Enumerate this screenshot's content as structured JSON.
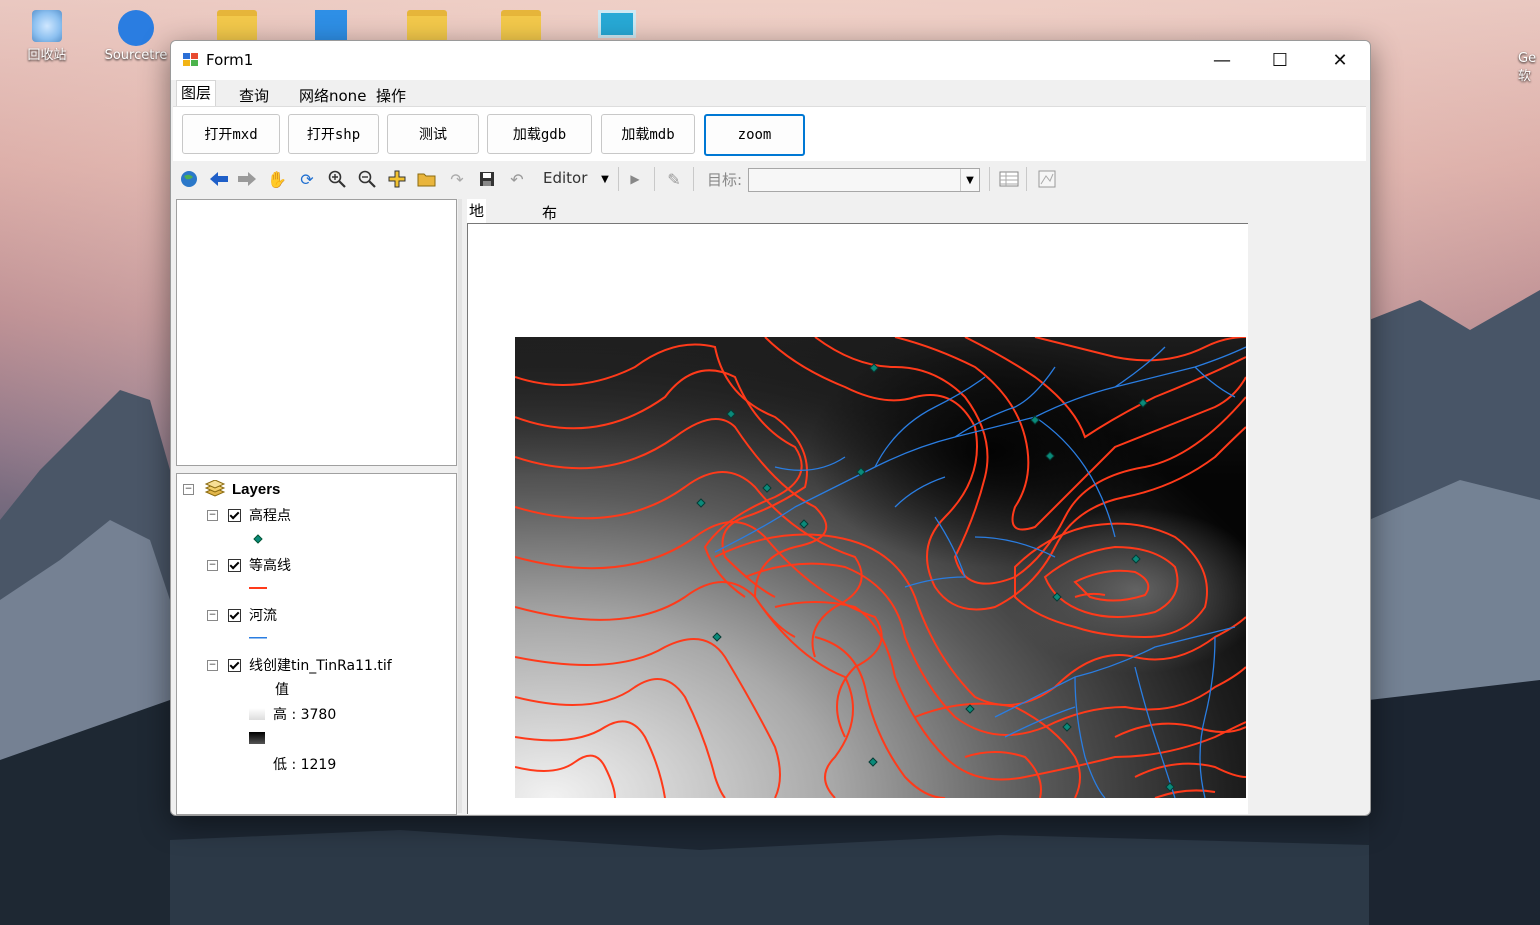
{
  "desktop": {
    "icons": [
      {
        "label": "回收站",
        "icon": "recycle-bin-icon"
      },
      {
        "label": "Sourcetre",
        "icon": "sourcetree-icon"
      },
      {
        "label": "",
        "icon": "folder-icon"
      },
      {
        "label": "",
        "icon": "tool-app-icon"
      },
      {
        "label": "",
        "icon": "folder-icon"
      },
      {
        "label": "",
        "icon": "folder-icon"
      },
      {
        "label": "",
        "icon": "monitor-icon"
      }
    ],
    "right_edge_text": [
      "Ge",
      "软"
    ]
  },
  "window": {
    "title": "Form1",
    "controls": {
      "minimize": "—",
      "maximize": "☐",
      "close": "✕"
    }
  },
  "menu": {
    "items": [
      "图层",
      "查询",
      "网络none",
      "操作"
    ],
    "active_index": 0
  },
  "buttons": [
    "打开mxd",
    "打开shp",
    "测试",
    "加载gdb",
    "加载mdb",
    "zoom"
  ],
  "toolbar": {
    "editor_label": "Editor",
    "target_label": "目标:",
    "target_value": ""
  },
  "view_tabs": [
    "地图视图",
    "布局视图"
  ],
  "toc": {
    "root": "Layers",
    "layers": [
      {
        "name": "高程点",
        "checked": true,
        "symbol": "point",
        "color": "#0a8a7a"
      },
      {
        "name": "等高线",
        "checked": true,
        "symbol": "line",
        "color": "#ff3a1a"
      },
      {
        "name": "河流",
        "checked": true,
        "symbol": "line",
        "color": "#2a7de1"
      },
      {
        "name": "线创建tin_TinRa11.tif",
        "checked": true,
        "symbol": "raster",
        "legend_title": "值",
        "high_label": "高 : 3780",
        "low_label": "低 : 1219"
      }
    ]
  },
  "colors": {
    "contour": "#ff3a1a",
    "river": "#2a7de1",
    "point": "#0a8a7a",
    "focus": "#0078d4"
  }
}
